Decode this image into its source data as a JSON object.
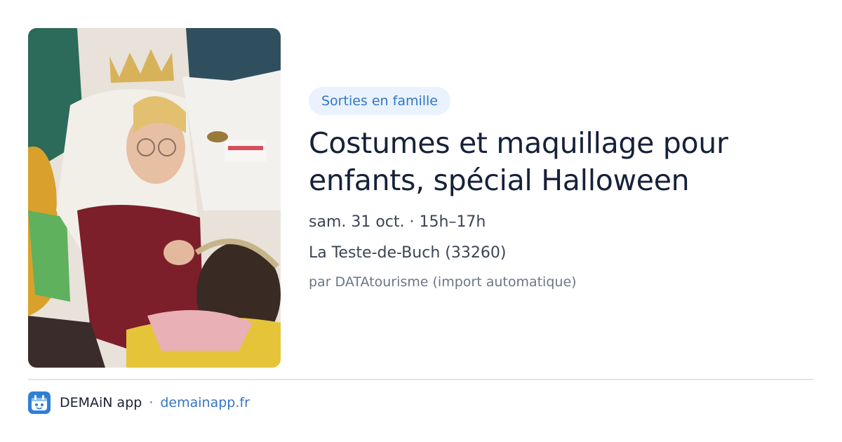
{
  "event": {
    "category": "Sorties en famille",
    "title": "Costumes et maquillage pour enfants, spécial Halloween",
    "datetime": "sam. 31 oct. · 15h–17h",
    "location": "La Teste-de-Buch (33260)",
    "source": "par DATAtourisme (import automatique)"
  },
  "footer": {
    "app_name": "DEMAiN app",
    "separator": "·",
    "domain": "demainapp.fr",
    "logo_icon": "demain-app-logo-icon"
  },
  "colors": {
    "accent": "#3476c6",
    "tag_background": "#e9f2fd",
    "title": "#16213a",
    "muted": "#6a7686",
    "divider": "#dfe6ec"
  }
}
